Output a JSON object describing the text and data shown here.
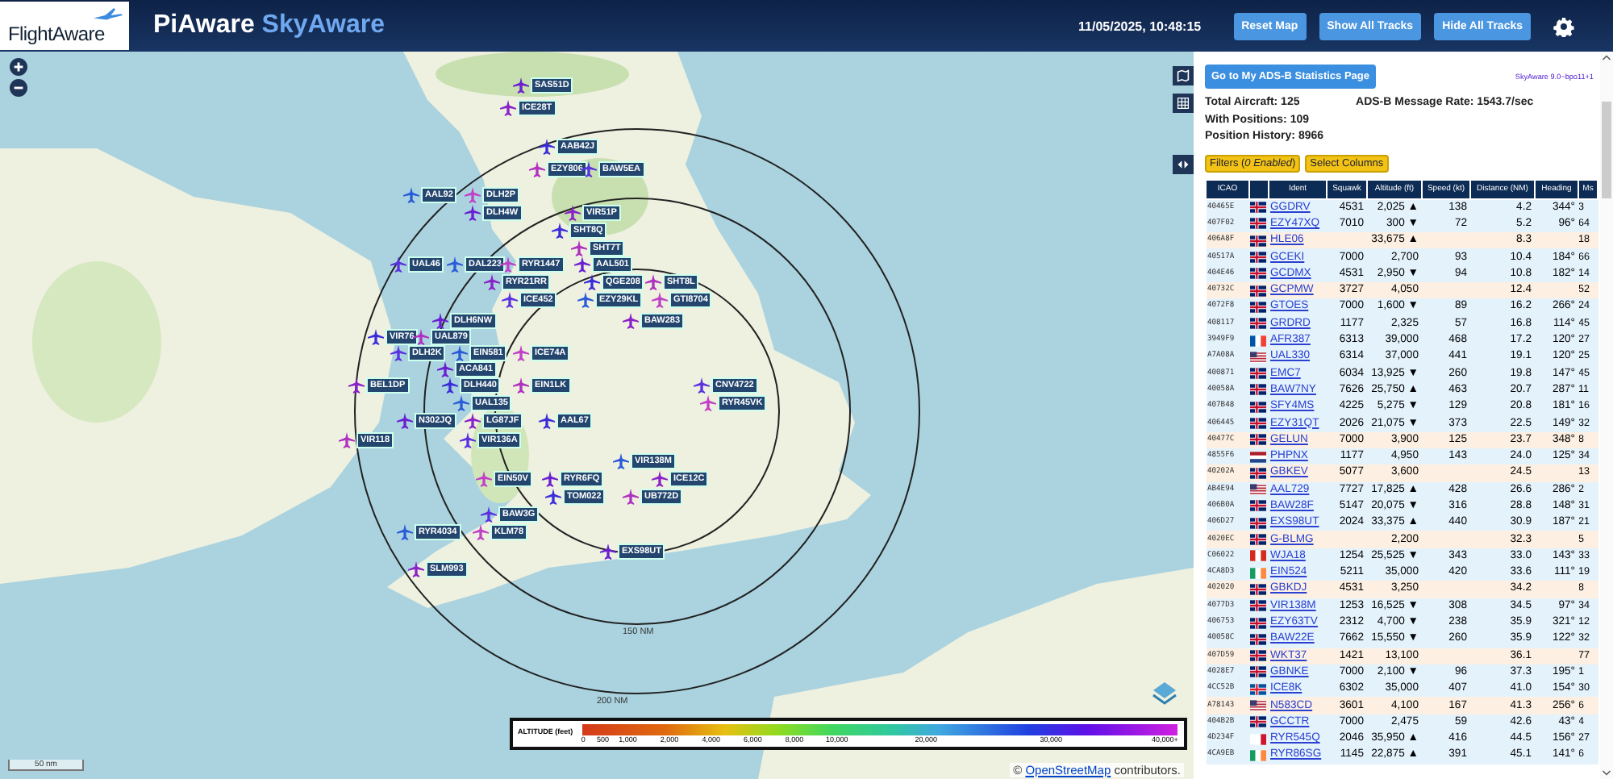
{
  "header": {
    "logo": "FlightAware",
    "title": "PiAware",
    "title_accent": "SkyAware",
    "datetime": "11/05/2025, 10:48:15",
    "buttons": [
      "Reset Map",
      "Show All Tracks",
      "Hide All Tracks"
    ]
  },
  "map": {
    "aircraft": [
      {
        "callsign": "SAS51D"
      },
      {
        "callsign": "ICE28T"
      },
      {
        "callsign": "AAB42J"
      },
      {
        "callsign": "EZY806"
      },
      {
        "callsign": "BAW5EA"
      },
      {
        "callsign": "AAL92"
      },
      {
        "callsign": "DLH2P"
      },
      {
        "callsign": "DLH4W"
      },
      {
        "callsign": "VIR51P"
      },
      {
        "callsign": "SHT8Q"
      },
      {
        "callsign": "SHT7T"
      },
      {
        "callsign": "UAL46"
      },
      {
        "callsign": "DAL223"
      },
      {
        "callsign": "RYR1447"
      },
      {
        "callsign": "AAL501"
      },
      {
        "callsign": "RYR21RR"
      },
      {
        "callsign": "QGE208"
      },
      {
        "callsign": "SHT8L"
      },
      {
        "callsign": "ICE452"
      },
      {
        "callsign": "EZY29KL"
      },
      {
        "callsign": "GTI8704"
      },
      {
        "callsign": "DLH6NW"
      },
      {
        "callsign": "BAW283"
      },
      {
        "callsign": "VIR76"
      },
      {
        "callsign": "UAL879"
      },
      {
        "callsign": "DLH2K"
      },
      {
        "callsign": "EIN581"
      },
      {
        "callsign": "ICE74A"
      },
      {
        "callsign": "ACA841"
      },
      {
        "callsign": "BEL1DP"
      },
      {
        "callsign": "DLH440"
      },
      {
        "callsign": "EIN1LK"
      },
      {
        "callsign": "CNV4722"
      },
      {
        "callsign": "UAL135"
      },
      {
        "callsign": "RYR45VK"
      },
      {
        "callsign": "N302JQ"
      },
      {
        "callsign": "LG87JF"
      },
      {
        "callsign": "AAL67"
      },
      {
        "callsign": "VIR118"
      },
      {
        "callsign": "VIR136A"
      },
      {
        "callsign": "VIR138M"
      },
      {
        "callsign": "EIN50V"
      },
      {
        "callsign": "RYR6FQ"
      },
      {
        "callsign": "ICE12C"
      },
      {
        "callsign": "TOM022"
      },
      {
        "callsign": "UB772D"
      },
      {
        "callsign": "BAW3G"
      },
      {
        "callsign": "RYR4034"
      },
      {
        "callsign": "KLM78"
      },
      {
        "callsign": "EXS98UT"
      },
      {
        "callsign": "SLM993"
      }
    ],
    "rings": [
      "150 NM",
      "200 NM"
    ],
    "scale": "50 nm",
    "legend": {
      "title": "ALTITUDE (feet)",
      "ticks": [
        "0",
        "500",
        "1,000",
        "2,000",
        "4,000",
        "6,000",
        "8,000",
        "10,000",
        "20,000",
        "30,000",
        "40,000+"
      ]
    },
    "attribution_link": "OpenStreetMap",
    "attribution_text": "contributors.",
    "attribution_mark": "©"
  },
  "panel": {
    "stats_button": "Go to My ADS-B Statistics Page",
    "version": "SkyAware 9.0~bpo11+1",
    "stats": [
      "Total Aircraft: 125",
      "With Positions: 109",
      "Position History: 8966"
    ],
    "message_rate": "ADS-B Message Rate: 1543.7/sec",
    "filters_button": "Filters (*0 Enabled*)",
    "columns_button": "Select Columns"
  },
  "table": {
    "columns": [
      "ICAO",
      "Ident",
      "Squawk",
      "Altitude (ft)",
      "Speed (kt)",
      "Distance (NM)",
      "Heading",
      "Ms"
    ],
    "rows": [
      {
        "icao": "40465E",
        "flag": {
          "kind": "gb"
        },
        "ident": "GGDRV",
        "squawk": "4531",
        "altitude": "2,025 ▲",
        "speed": "138",
        "distance": "4.2",
        "heading": "344°",
        "column_9": "3",
        "kind": "blue"
      },
      {
        "icao": "407F02",
        "flag": {
          "kind": "gb"
        },
        "ident": "EZY47XQ",
        "squawk": "7010",
        "altitude": "300 ▼",
        "speed": "72",
        "distance": "5.2",
        "heading": "96°",
        "column_9": "64",
        "kind": "blue"
      },
      {
        "icao": "406A8F",
        "flag": {
          "kind": "gb"
        },
        "ident": "HLE06",
        "altitude": "33,675 ▲",
        "distance": "8.3",
        "column_9": "18",
        "kind": "orange"
      },
      {
        "icao": "40517A",
        "flag": {
          "kind": "gb"
        },
        "ident": "GCEKI",
        "squawk": "7000",
        "altitude": "2,700",
        "speed": "93",
        "distance": "10.4",
        "heading": "184°",
        "column_9": "66",
        "kind": "blue"
      },
      {
        "icao": "404E46",
        "flag": {
          "kind": "gb"
        },
        "ident": "GCDMX",
        "squawk": "4531",
        "altitude": "2,950 ▼",
        "speed": "94",
        "distance": "10.8",
        "heading": "182°",
        "column_9": "14",
        "kind": "blue"
      },
      {
        "icao": "40732C",
        "flag": {
          "kind": "gb"
        },
        "ident": "GCPMW",
        "squawk": "3727",
        "altitude": "4,050",
        "distance": "12.4",
        "column_9": "52",
        "kind": "orange"
      },
      {
        "icao": "4072F8",
        "flag": {
          "kind": "gb"
        },
        "ident": "GTOES",
        "squawk": "7000",
        "altitude": "1,600 ▼",
        "speed": "89",
        "distance": "16.2",
        "heading": "266°",
        "column_9": "24",
        "kind": "blue"
      },
      {
        "icao": "408117",
        "flag": {
          "kind": "gb"
        },
        "ident": "GRDRD",
        "squawk": "1177",
        "altitude": "2,325",
        "speed": "57",
        "distance": "16.8",
        "heading": "114°",
        "column_9": "45",
        "kind": "blue"
      },
      {
        "icao": "3949F9",
        "flag": {
          "kind": "fr"
        },
        "ident": "AFR387",
        "squawk": "6313",
        "altitude": "39,000",
        "speed": "468",
        "distance": "17.2",
        "heading": "120°",
        "column_9": "27",
        "kind": "blue"
      },
      {
        "icao": "A7A08A",
        "flag": {
          "kind": "us"
        },
        "ident": "UAL330",
        "squawk": "6314",
        "altitude": "37,000",
        "speed": "441",
        "distance": "19.1",
        "heading": "120°",
        "column_9": "25",
        "kind": "blue"
      },
      {
        "icao": "400871",
        "flag": {
          "kind": "gb"
        },
        "ident": "EMC7",
        "squawk": "6034",
        "altitude": "13,925 ▼",
        "speed": "260",
        "distance": "19.8",
        "heading": "147°",
        "column_9": "45",
        "kind": "blue"
      },
      {
        "icao": "40058A",
        "flag": {
          "kind": "gb"
        },
        "ident": "BAW7NY",
        "squawk": "7626",
        "altitude": "25,750 ▲",
        "speed": "463",
        "distance": "20.7",
        "heading": "287°",
        "column_9": "11",
        "kind": "blue"
      },
      {
        "icao": "407B48",
        "flag": {
          "kind": "gb"
        },
        "ident": "SFY4MS",
        "squawk": "4225",
        "altitude": "5,275 ▼",
        "speed": "129",
        "distance": "20.8",
        "heading": "181°",
        "column_9": "16",
        "kind": "blue"
      },
      {
        "icao": "406445",
        "flag": {
          "kind": "gb"
        },
        "ident": "EZY31QT",
        "squawk": "2026",
        "altitude": "21,075 ▼",
        "speed": "373",
        "distance": "22.5",
        "heading": "149°",
        "column_9": "32",
        "kind": "blue"
      },
      {
        "icao": "40477C",
        "flag": {
          "kind": "gb"
        },
        "ident": "GELUN",
        "squawk": "7000",
        "altitude": "3,900",
        "speed": "125",
        "distance": "23.7",
        "heading": "348°",
        "column_9": "8",
        "kind": "orange"
      },
      {
        "icao": "4855F6",
        "flag": {
          "kind": "nl"
        },
        "ident": "PHPNX",
        "squawk": "1177",
        "altitude": "4,950",
        "speed": "143",
        "distance": "24.0",
        "heading": "125°",
        "column_9": "34",
        "kind": "blue"
      },
      {
        "icao": "40202A",
        "flag": {
          "kind": "gb"
        },
        "ident": "GBKEV",
        "squawk": "5077",
        "altitude": "3,600",
        "distance": "24.5",
        "column_9": "13",
        "kind": "orange"
      },
      {
        "icao": "AB4E94",
        "flag": {
          "kind": "us"
        },
        "ident": "AAL729",
        "squawk": "7727",
        "altitude": "17,825 ▲",
        "speed": "428",
        "distance": "26.6",
        "heading": "286°",
        "column_9": "2",
        "kind": "blue"
      },
      {
        "icao": "406B0A",
        "flag": {
          "kind": "gb"
        },
        "ident": "BAW28F",
        "squawk": "5147",
        "altitude": "20,075 ▼",
        "speed": "316",
        "distance": "28.8",
        "heading": "148°",
        "column_9": "31",
        "kind": "blue"
      },
      {
        "icao": "406D27",
        "flag": {
          "kind": "gb"
        },
        "ident": "EXS98UT",
        "squawk": "2024",
        "altitude": "33,375 ▲",
        "speed": "440",
        "distance": "30.9",
        "heading": "187°",
        "column_9": "21",
        "kind": "blue"
      },
      {
        "icao": "4020EC",
        "flag": {
          "kind": "gb"
        },
        "ident": "G-BLMG",
        "altitude": "2,200",
        "distance": "32.3",
        "column_9": "5",
        "kind": "orange"
      },
      {
        "icao": "C06022",
        "flag": {
          "kind": "ca"
        },
        "ident": "WJA18",
        "squawk": "1254",
        "altitude": "25,525 ▼",
        "speed": "343",
        "distance": "33.0",
        "heading": "143°",
        "column_9": "33",
        "kind": "blue"
      },
      {
        "icao": "4CA8D3",
        "flag": {
          "kind": "ie"
        },
        "ident": "EIN524",
        "squawk": "5211",
        "altitude": "35,000",
        "speed": "420",
        "distance": "33.6",
        "heading": "111°",
        "column_9": "19",
        "kind": "blue"
      },
      {
        "icao": "402020",
        "flag": {
          "kind": "gb"
        },
        "ident": "GBKDJ",
        "squawk": "4531",
        "altitude": "3,250",
        "distance": "34.2",
        "column_9": "8",
        "kind": "orange"
      },
      {
        "icao": "4077D3",
        "flag": {
          "kind": "gb"
        },
        "ident": "VIR138M",
        "squawk": "1253",
        "altitude": "16,525 ▼",
        "speed": "308",
        "distance": "34.5",
        "heading": "97°",
        "column_9": "34",
        "kind": "blue"
      },
      {
        "icao": "406753",
        "flag": {
          "kind": "gb"
        },
        "ident": "EZY63TV",
        "squawk": "2312",
        "altitude": "4,700 ▼",
        "speed": "238",
        "distance": "35.9",
        "heading": "321°",
        "column_9": "12",
        "kind": "blue"
      },
      {
        "icao": "40058C",
        "flag": {
          "kind": "gb"
        },
        "ident": "BAW22E",
        "squawk": "7662",
        "altitude": "15,550 ▼",
        "speed": "260",
        "distance": "35.9",
        "heading": "122°",
        "column_9": "32",
        "kind": "blue"
      },
      {
        "icao": "407D59",
        "flag": {
          "kind": "gb"
        },
        "ident": "WKT37",
        "squawk": "1421",
        "altitude": "13,100",
        "distance": "36.1",
        "column_9": "77",
        "kind": "orange"
      },
      {
        "icao": "4028E7",
        "flag": {
          "kind": "gb"
        },
        "ident": "GBNKE",
        "squawk": "7000",
        "altitude": "2,100 ▼",
        "speed": "96",
        "distance": "37.3",
        "heading": "195°",
        "column_9": "1",
        "kind": "blue"
      },
      {
        "icao": "4CC52B",
        "flag": {
          "kind": "is"
        },
        "ident": "ICE8K",
        "squawk": "6302",
        "altitude": "35,000",
        "speed": "407",
        "distance": "41.0",
        "heading": "154°",
        "column_9": "30",
        "kind": "blue"
      },
      {
        "icao": "A78143",
        "flag": {
          "kind": "us"
        },
        "ident": "N583CD",
        "squawk": "3601",
        "altitude": "4,100",
        "speed": "167",
        "distance": "41.3",
        "heading": "256°",
        "column_9": "6",
        "kind": "orange"
      },
      {
        "icao": "404B2B",
        "flag": {
          "kind": "gb"
        },
        "ident": "GCCTR",
        "squawk": "7000",
        "altitude": "2,475",
        "speed": "59",
        "distance": "42.6",
        "heading": "43°",
        "column_9": "4",
        "kind": "blue"
      },
      {
        "icao": "4D234F",
        "flag": {
          "kind": "mt"
        },
        "ident": "RYR545Q",
        "squawk": "2046",
        "altitude": "35,950 ▲",
        "speed": "416",
        "distance": "44.5",
        "heading": "156°",
        "column_9": "27",
        "kind": "blue"
      },
      {
        "icao": "4CA9EB",
        "flag": {
          "kind": "ie"
        },
        "ident": "RYR86SG",
        "squawk": "1145",
        "altitude": "22,875 ▲",
        "speed": "391",
        "distance": "45.1",
        "heading": "141°",
        "column_9": "6",
        "kind": "blue"
      }
    ]
  }
}
